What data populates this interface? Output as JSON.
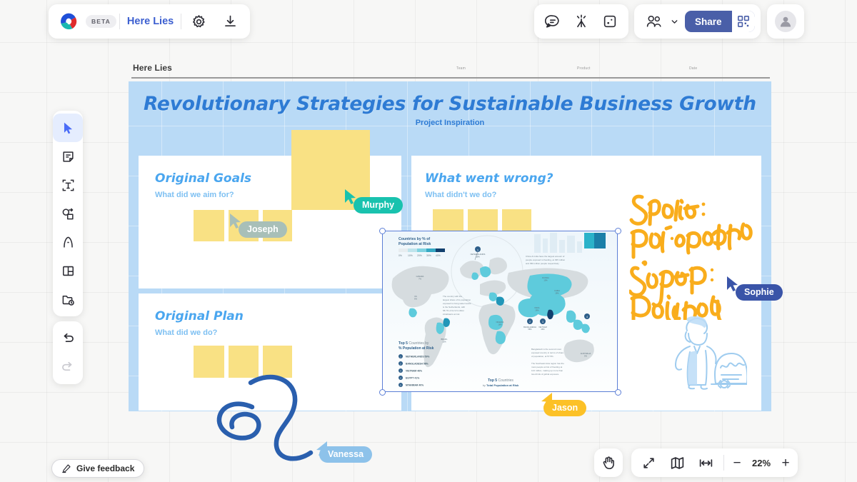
{
  "app": {
    "badge": "BETA",
    "doc_title": "Here Lies",
    "logo_icon": "logo-icon",
    "settings_icon": "gear-icon",
    "download_icon": "download-icon"
  },
  "top_right": {
    "comment_icon": "comment-icon",
    "reactions_icon": "celebrate-icon",
    "timer_icon": "timer-icon",
    "participants_icon": "people-icon",
    "participants_chevron": "chevron-down-icon",
    "share_label": "Share",
    "qr_icon": "qr-code-icon",
    "avatar": "avatar-icon"
  },
  "toolbar": {
    "items": [
      {
        "name": "select-tool",
        "icon": "cursor-icon",
        "selected": true
      },
      {
        "name": "sticky-note-tool",
        "icon": "sticky-note-icon",
        "selected": false
      },
      {
        "name": "text-tool",
        "icon": "text-icon",
        "selected": false
      },
      {
        "name": "shapes-tool",
        "icon": "shapes-icon",
        "selected": false
      },
      {
        "name": "pen-tool",
        "icon": "pen-icon",
        "selected": false
      },
      {
        "name": "frame-tool",
        "icon": "frame-icon",
        "selected": false
      },
      {
        "name": "upload-tool",
        "icon": "upload-file-icon",
        "selected": false
      }
    ],
    "undo_icon": "undo-icon",
    "redo_icon": "redo-icon"
  },
  "footer": {
    "feedback_label": "Give feedback",
    "feedback_icon": "pencil-icon",
    "hand_icon": "hand-icon",
    "fit_icon": "fit-screen-icon",
    "minimap_icon": "map-icon",
    "width_icon": "fit-width-icon",
    "zoom_out": "−",
    "zoom_level": "22%",
    "zoom_in": "+"
  },
  "board": {
    "header_title": "Here Lies",
    "header_fields": [
      "Team",
      "Product",
      "Date"
    ],
    "title": "Revolutionary Strategies for Sustainable Business Growth",
    "subtitle": "Project Inspiration",
    "panels": [
      {
        "name": "original-goals",
        "title": "Original Goals",
        "subtitle": "What did we aim for?",
        "notes": 4
      },
      {
        "name": "what-went-wrong",
        "title": "What went wrong?",
        "subtitle": "What didn't we do?",
        "notes": 3
      },
      {
        "name": "original-plan",
        "title": "Original Plan",
        "subtitle": "What did we do?",
        "notes": 3
      }
    ],
    "handwriting": [
      "Sophie:",
      "Ppt. presenter",
      "Joseph:",
      "Design, QA"
    ]
  },
  "map_asset": {
    "legend_title_line1": "Countries by % of",
    "legend_title_line2": "Population at Risk",
    "legend_ticks": [
      "0%",
      "10%",
      "20%",
      "30%",
      "40%"
    ],
    "callout_netherlands": "NETHERLANDS",
    "note_right": "China & India have the largest amount of people exposed to flooding, at 395 million and 390 million people respectively",
    "note_left": "The country with the largest share of its population exposed to rising water levels is the Netherlands, with 58.7% or its 9.6 million inhabitants at risk",
    "note_bottom": "Bangladesh is the second most exposed country in terms of share of population, at 57.5%. The Southeast Asia region has the most people at risk of flooding at 124 million, making up more than two-thirds of global exposure.",
    "top5_title_line1": "Top 5 Countries by",
    "top5_title_line2": "% Population at Risk",
    "top5": [
      {
        "rank": 1,
        "country": "NETHERLANDS",
        "value": "59%"
      },
      {
        "rank": 2,
        "country": "BANGLADESH",
        "value": "58%"
      },
      {
        "rank": 3,
        "country": "VIETNAM",
        "value": "46%"
      },
      {
        "rank": 4,
        "country": "EGYPT",
        "value": "41%"
      },
      {
        "rank": 5,
        "country": "MYANMAR",
        "value": "40%"
      }
    ],
    "footer_line1": "Top 5 Countries",
    "footer_line2": "by Total Population at Risk"
  },
  "cursors": [
    {
      "name": "cursor-murphy",
      "label": "Murphy",
      "color": "#19c2ae"
    },
    {
      "name": "cursor-joseph",
      "label": "Joseph",
      "color": "#a8bfb8"
    },
    {
      "name": "cursor-sophie",
      "label": "Sophie",
      "color": "#3a54a8"
    },
    {
      "name": "cursor-jason",
      "label": "Jason",
      "color": "#fcc127"
    },
    {
      "name": "cursor-vanessa",
      "label": "Vanessa",
      "color": "#8dc2ea"
    }
  ],
  "colors": {
    "board_bg": "#b9daf6",
    "note": "#f9e184",
    "title_blue": "#2e7bd4",
    "panel_title": "#4aa6ef",
    "ink_orange": "#f9ad1c",
    "ink_blue": "#2a5fae",
    "share_indigo": "#4a5fa8"
  }
}
